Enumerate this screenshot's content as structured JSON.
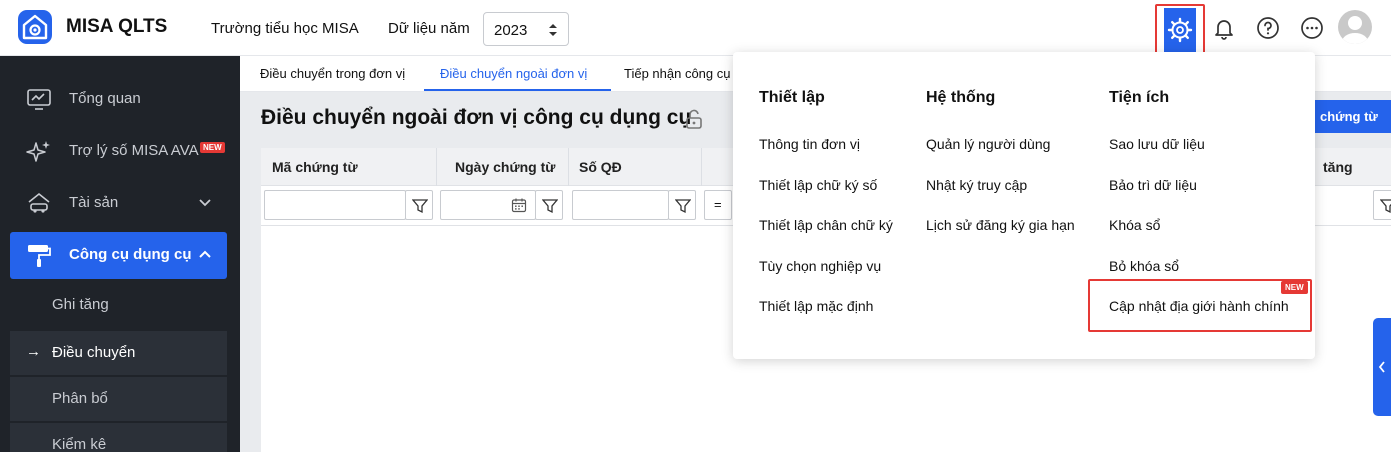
{
  "header": {
    "app_title": "MISA QLTS",
    "school": "Trường tiểu học MISA",
    "year_label": "Dữ liệu năm",
    "year_value": "2023"
  },
  "sidebar": {
    "items": [
      {
        "label": "Tổng quan",
        "icon": "dashboard-icon"
      },
      {
        "label": "Trợ lý số MISA AVA",
        "icon": "sparkle-icon",
        "badge": "NEW"
      },
      {
        "label": "Tài sản",
        "icon": "car-house-icon"
      },
      {
        "label": "Công cụ dụng cụ",
        "icon": "paint-roller-icon"
      }
    ],
    "sub_items": [
      {
        "label": "Ghi tăng"
      },
      {
        "label": "Điều chuyển",
        "prefix": "→"
      },
      {
        "label": "Phân bổ"
      },
      {
        "label": "Kiểm kê"
      }
    ]
  },
  "tabs": [
    {
      "label": "Điều chuyển trong đơn vị"
    },
    {
      "label": "Điều chuyển ngoài đơn vị"
    },
    {
      "label": "Tiếp nhận công cụ"
    }
  ],
  "main": {
    "title": "Điều chuyển ngoài đơn vị công cụ dụng cụ",
    "action_button": "chứng từ",
    "columns": [
      "Mã chứng từ",
      "Ngày chứng từ",
      "Số QĐ",
      "tăng"
    ],
    "filter_operator": "="
  },
  "settings_menu": {
    "columns": [
      {
        "title": "Thiết lập",
        "items": [
          "Thông tin đơn vị",
          "Thiết lập chữ ký số",
          "Thiết lập chân chữ ký",
          "Tùy chọn nghiệp vụ",
          "Thiết lập mặc định"
        ]
      },
      {
        "title": "Hệ thống",
        "items": [
          "Quản lý người dùng",
          "Nhật ký truy cập",
          "Lịch sử đăng ký gia hạn"
        ]
      },
      {
        "title": "Tiện ích",
        "items": [
          "Sao lưu dữ liệu",
          "Bảo trì dữ liệu",
          "Khóa sổ",
          "Bỏ khóa sổ",
          "Cập nhật địa giới hành chính"
        ]
      }
    ],
    "new_badge": "NEW"
  },
  "colors": {
    "accent": "#2563eb",
    "sidebar_bg": "#1f2329",
    "highlight": "#e53935"
  }
}
